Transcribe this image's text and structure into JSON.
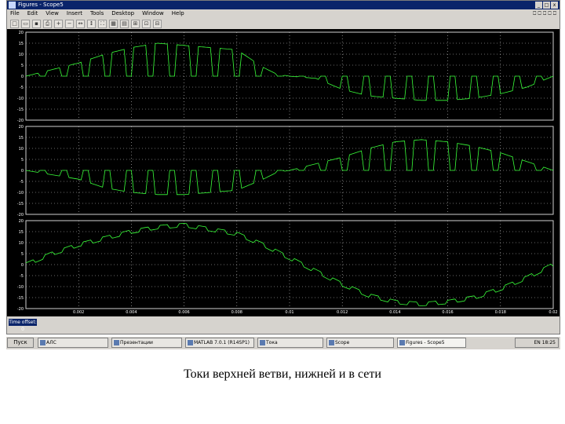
{
  "window": {
    "title": "Figures - Scope5",
    "controls": [
      "_",
      "□",
      "x"
    ]
  },
  "menu": {
    "items": [
      "File",
      "Edit",
      "View",
      "Insert",
      "Tools",
      "Desktop",
      "Window",
      "Help"
    ],
    "right_glyphs": "⎕ ⎕ ⎕ ⎕ ⎕"
  },
  "toolbar": {
    "buttons": [
      "new",
      "open",
      "save",
      "print",
      "zoom-in",
      "zoom-out",
      "pan",
      "rotate",
      "datatips",
      "axes",
      "legend",
      "colorbar",
      "props",
      "scope"
    ]
  },
  "colors": {
    "plot_bg": "#000000",
    "trace": "#39ff39",
    "grid": "#cfcfcf",
    "window": "#d6d3ce",
    "titlebar": "#0a246a"
  },
  "status": {
    "label": "Time offset: 0"
  },
  "taskbar": {
    "start_label": "Пуск",
    "tasks": [
      {
        "label": "АЛС",
        "active": false
      },
      {
        "label": "Презентации",
        "active": false
      },
      {
        "label": "MATLAB 7.0.1 (R14SP1)",
        "active": false
      },
      {
        "label": "Тока",
        "active": false
      },
      {
        "label": "Scope",
        "active": false
      },
      {
        "label": "Figures - Scope5",
        "active": true
      }
    ],
    "tray": "EN  18:25"
  },
  "caption": "Токи верхней ветви, нижней и в сети",
  "chart_data": [
    {
      "type": "line",
      "title": "",
      "yticks": [
        "20",
        "15",
        "10",
        "5",
        "0",
        "-5",
        "-10",
        "-15",
        "-20"
      ],
      "ylim": [
        -20,
        20
      ],
      "xlim": [
        0,
        0.02
      ],
      "description_series": "верхняя ветвь",
      "series": [
        {
          "x": [
            0,
            0.001,
            0.002,
            0.003,
            0.004,
            0.005,
            0.006,
            0.007,
            0.008,
            0.009,
            0.0095,
            0.01,
            0.011,
            0.012,
            0.013,
            0.014,
            0.015,
            0.016,
            0.017,
            0.018,
            0.019,
            0.02
          ],
          "y": [
            0,
            3,
            6,
            10,
            13,
            15,
            14,
            13,
            12,
            4,
            1,
            0,
            -1,
            -6,
            -9,
            -10,
            -11,
            -11,
            -10,
            -8,
            -5,
            0
          ],
          "pulsed": true
        }
      ]
    },
    {
      "type": "line",
      "yticks": [
        "20",
        "15",
        "10",
        "5",
        "0",
        "-5",
        "-10",
        "-15",
        "-20"
      ],
      "ylim": [
        -20,
        20
      ],
      "xlim": [
        0,
        0.02
      ],
      "series": [
        {
          "x": [
            0,
            0.001,
            0.002,
            0.003,
            0.004,
            0.005,
            0.006,
            0.007,
            0.008,
            0.009,
            0.0095,
            0.01,
            0.011,
            0.012,
            0.013,
            0.014,
            0.015,
            0.016,
            0.017,
            0.018,
            0.019,
            0.02
          ],
          "y": [
            0,
            -2,
            -4,
            -8,
            -10,
            -11,
            -11,
            -10,
            -9,
            -4,
            -1,
            0,
            3,
            6,
            10,
            13,
            14,
            13,
            11,
            8,
            4,
            0
          ],
          "pulsed": true
        }
      ]
    },
    {
      "type": "line",
      "yticks": [
        "20",
        "15",
        "10",
        "5",
        "0",
        "-5",
        "-10",
        "-15",
        "-20"
      ],
      "ylim": [
        -20,
        20
      ],
      "xlim": [
        0,
        0.02
      ],
      "xticks": [
        "0.002",
        "0.004",
        "0.006",
        "0.008",
        "0.01",
        "0.012",
        "0.014",
        "0.016",
        "0.018",
        "0.02"
      ],
      "series": [
        {
          "x": [
            0,
            0.001,
            0.002,
            0.003,
            0.004,
            0.005,
            0.006,
            0.007,
            0.008,
            0.009,
            0.01,
            0.011,
            0.012,
            0.013,
            0.014,
            0.015,
            0.016,
            0.017,
            0.018,
            0.019,
            0.02
          ],
          "y": [
            0,
            5,
            9,
            12,
            15,
            17,
            18,
            16,
            14,
            9,
            3,
            -3,
            -9,
            -14,
            -17,
            -18,
            -17,
            -15,
            -11,
            -6,
            0
          ],
          "pulsed": false
        }
      ]
    }
  ]
}
